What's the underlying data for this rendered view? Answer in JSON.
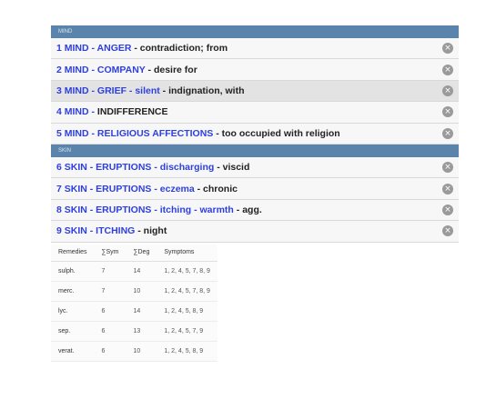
{
  "sections": [
    {
      "header": "MIND",
      "rubrics": [
        {
          "parts": [
            {
              "text": "1 MIND - ANGER",
              "style": "blue"
            },
            {
              "text": " - contradiction; from",
              "style": "black"
            }
          ]
        },
        {
          "parts": [
            {
              "text": "2 MIND - COMPANY",
              "style": "blue"
            },
            {
              "text": " - desire for",
              "style": "black"
            }
          ]
        },
        {
          "parts": [
            {
              "text": "3 MIND - GRIEF - silent",
              "style": "blue"
            },
            {
              "text": " - indignation, with",
              "style": "black"
            }
          ],
          "selected": true
        },
        {
          "parts": [
            {
              "text": "4 MIND - ",
              "style": "blue"
            },
            {
              "text": "INDIFFERENCE",
              "style": "black"
            }
          ]
        },
        {
          "parts": [
            {
              "text": "5 MIND - RELIGIOUS AFFECTIONS",
              "style": "blue"
            },
            {
              "text": " - too occupied with religion",
              "style": "black"
            }
          ]
        }
      ]
    },
    {
      "header": "SKIN",
      "rubrics": [
        {
          "parts": [
            {
              "text": "6 SKIN - ERUPTIONS - discharging",
              "style": "blue"
            },
            {
              "text": " - viscid",
              "style": "black"
            }
          ]
        },
        {
          "parts": [
            {
              "text": "7 SKIN - ERUPTIONS - eczema",
              "style": "blue"
            },
            {
              "text": " - chronic",
              "style": "black"
            }
          ]
        },
        {
          "parts": [
            {
              "text": "8 SKIN - ERUPTIONS - itching - warmth",
              "style": "blue"
            },
            {
              "text": " - agg.",
              "style": "black"
            }
          ]
        },
        {
          "parts": [
            {
              "text": "9 SKIN - ITCHING",
              "style": "blue"
            },
            {
              "text": " - night",
              "style": "black"
            }
          ]
        }
      ]
    }
  ],
  "remove_icon_glyph": "×",
  "table": {
    "headers": [
      "Remedies",
      "∑Sym",
      "∑Deg",
      "Symptoms"
    ],
    "rows": [
      [
        "sulph.",
        "7",
        "14",
        "1, 2, 4, 5, 7, 8, 9"
      ],
      [
        "merc.",
        "7",
        "10",
        "1, 2, 4, 5, 7, 8, 9"
      ],
      [
        "lyc.",
        "6",
        "14",
        "1, 2, 4, 5, 8, 9"
      ],
      [
        "sep.",
        "6",
        "13",
        "1, 2, 4, 5, 7, 9"
      ],
      [
        "verat.",
        "6",
        "10",
        "1, 2, 4, 5, 8, 9"
      ]
    ]
  },
  "colors": {
    "section_header_bg": "#5b84ad",
    "rubric_blue": "#2d3fe0",
    "rubric_black": "#222222",
    "selected_row_bg": "#e3e3e3"
  }
}
